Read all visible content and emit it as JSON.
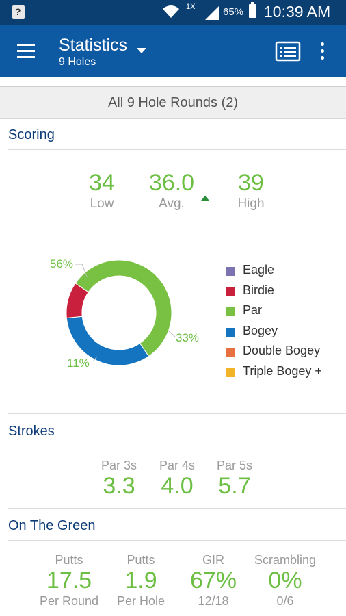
{
  "status_bar": {
    "sim_glyph": "?",
    "network_label": "1X",
    "battery": "65%",
    "time": "10:39 AM"
  },
  "app_bar": {
    "title": "Statistics",
    "subtitle": "9 Holes"
  },
  "filter": {
    "label": "All 9 Hole Rounds (2)"
  },
  "scoring": {
    "title": "Scoring",
    "low": {
      "value": "34",
      "label": "Low"
    },
    "avg": {
      "value": "36.0",
      "label": "Avg."
    },
    "high": {
      "value": "39",
      "label": "High"
    },
    "distribution": [
      {
        "name": "Eagle",
        "percent": 0,
        "color": "#7b74b1",
        "label": ""
      },
      {
        "name": "Birdie",
        "percent": 11,
        "color": "#c8203d",
        "label": "11%"
      },
      {
        "name": "Par",
        "percent": 56,
        "color": "#79c143",
        "label": "56%"
      },
      {
        "name": "Bogey",
        "percent": 33,
        "color": "#1474bf",
        "label": "33%"
      },
      {
        "name": "Double Bogey",
        "percent": 0,
        "color": "#e87040",
        "label": ""
      },
      {
        "name": "Triple Bogey +",
        "percent": 0,
        "color": "#f2b429",
        "label": ""
      }
    ]
  },
  "strokes": {
    "title": "Strokes",
    "items": [
      {
        "label": "Par 3s",
        "value": "3.3"
      },
      {
        "label": "Par 4s",
        "value": "4.0"
      },
      {
        "label": "Par 5s",
        "value": "5.7"
      }
    ]
  },
  "green": {
    "title": "On The Green",
    "items": [
      {
        "label": "Putts",
        "value": "17.5",
        "sub": "Per Round"
      },
      {
        "label": "Putts",
        "value": "1.9",
        "sub": "Per Hole"
      },
      {
        "label": "GIR",
        "value": "67%",
        "sub": "12/18"
      },
      {
        "label": "Scrambling",
        "value": "0%",
        "sub": "0/6"
      }
    ]
  }
}
